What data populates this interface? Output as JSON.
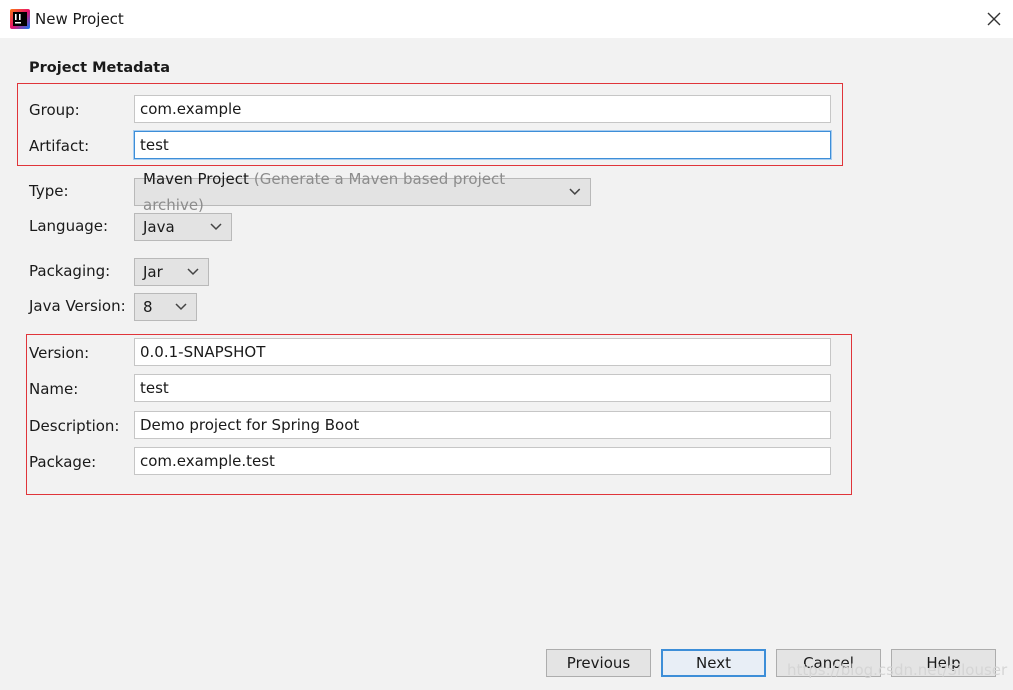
{
  "window": {
    "title": "New Project",
    "app_icon": "intellij-icon",
    "close_icon": "close-icon"
  },
  "metadata": {
    "section_title": "Project Metadata",
    "group": {
      "label": "Group:",
      "value": "com.example"
    },
    "artifact": {
      "label": "Artifact:",
      "value": "test"
    },
    "type": {
      "label": "Type:",
      "value": "Maven Project",
      "hint": "(Generate a Maven based project archive)"
    },
    "language": {
      "label": "Language:",
      "value": "Java"
    },
    "packaging": {
      "label": "Packaging:",
      "value": "Jar"
    },
    "java_version": {
      "label": "Java Version:",
      "value": "8"
    },
    "version": {
      "label": "Version:",
      "value": "0.0.1-SNAPSHOT"
    },
    "name": {
      "label": "Name:",
      "value": "test"
    },
    "description": {
      "label": "Description:",
      "value": "Demo project for Spring Boot"
    },
    "package": {
      "label": "Package:",
      "value": "com.example.test"
    }
  },
  "buttons": {
    "previous": "Previous",
    "next": "Next",
    "cancel": "Cancel",
    "help": "Help"
  },
  "watermark": "https://blog.csdn.net/Silouser",
  "colors": {
    "highlight_box": "#e0353a",
    "focus": "#3d8ed8",
    "background": "#f2f2f2"
  }
}
